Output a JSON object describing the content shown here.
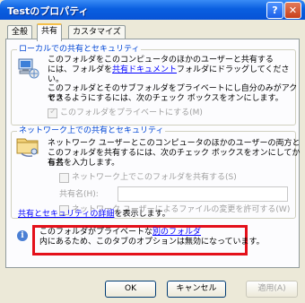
{
  "window": {
    "title": "Testのプロパティ",
    "help_glyph": "?",
    "close_glyph": "✕"
  },
  "tabs": [
    {
      "label": "全般"
    },
    {
      "label": "共有"
    },
    {
      "label": "カスタマイズ"
    }
  ],
  "local_sharing": {
    "group_title": "ローカルでの共有とセキュリティ",
    "line1": "このフォルダをこのコンピュータのほかのユーザーと共有する",
    "line2_a": "には、フォルダを",
    "line2_link": "共有ドキュメント",
    "line2_b": "フォルダにドラッグしてください。",
    "line3": "このフォルダとそのサブフォルダをプライベートにし自分のみがアクセス",
    "line4": "できるようにするには、次のチェック ボックスをオンにします。",
    "private_checkbox_label": "このフォルダをプライベートにする(M)",
    "private_checked": true
  },
  "network_sharing": {
    "group_title": "ネットワーク上での共有とセキュリティ",
    "line1": "ネットワーク ユーザーとこのコンピュータのほかのユーザーの両方と",
    "line2": "このフォルダを共有するには、次のチェック ボックスをオンにしてから共",
    "line3": "有名を入力します。",
    "share_checkbox_label": "ネットワーク上でこのフォルダを共有する(S)",
    "share_name_label": "共有名(H):",
    "share_name_value": "",
    "allow_change_label": "ネットワーク ユーザーによるファイルの変更を許可する(W)",
    "details_link": "共有とセキュリティの詳細",
    "details_suffix": "を表示します。"
  },
  "info": {
    "line1_a": "このフォルダがプライベートな",
    "line1_link": "別のフォルダ",
    "line2": "内にあるため、このタブのオプションは無効になっています。"
  },
  "buttons": {
    "ok": "OK",
    "cancel": "キャンセル",
    "apply": "適用(A)"
  }
}
